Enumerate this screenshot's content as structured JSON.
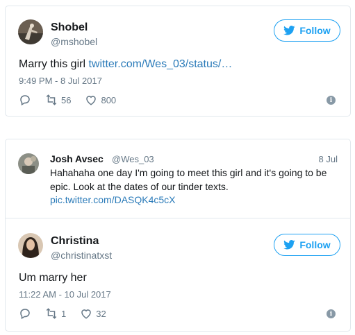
{
  "accent_color": "#1da1f2",
  "link_color": "#2b7bb9",
  "tweet1": {
    "name": "Shobel",
    "handle": "@mshobel",
    "follow_label": "Follow",
    "text": "Marry this girl ",
    "link": "twitter.com/Wes_03/status/…",
    "timestamp": "9:49 PM - 8 Jul 2017",
    "retweets": "56",
    "likes": "800"
  },
  "quoted": {
    "name": "Josh Avsec",
    "handle": "@Wes_03",
    "date": "8 Jul",
    "text_line1": "Hahahaha one day I'm going to meet this girl and it's going to be",
    "text_line2": "epic. Look at the dates of our tinder texts.",
    "link": "pic.twitter.com/DASQK4c5cX"
  },
  "tweet2": {
    "name": "Christina",
    "handle": "@christinatxst",
    "follow_label": "Follow",
    "text": "Um marry her",
    "timestamp": "11:22 AM - 10 Jul 2017",
    "retweets": "1",
    "likes": "32"
  }
}
